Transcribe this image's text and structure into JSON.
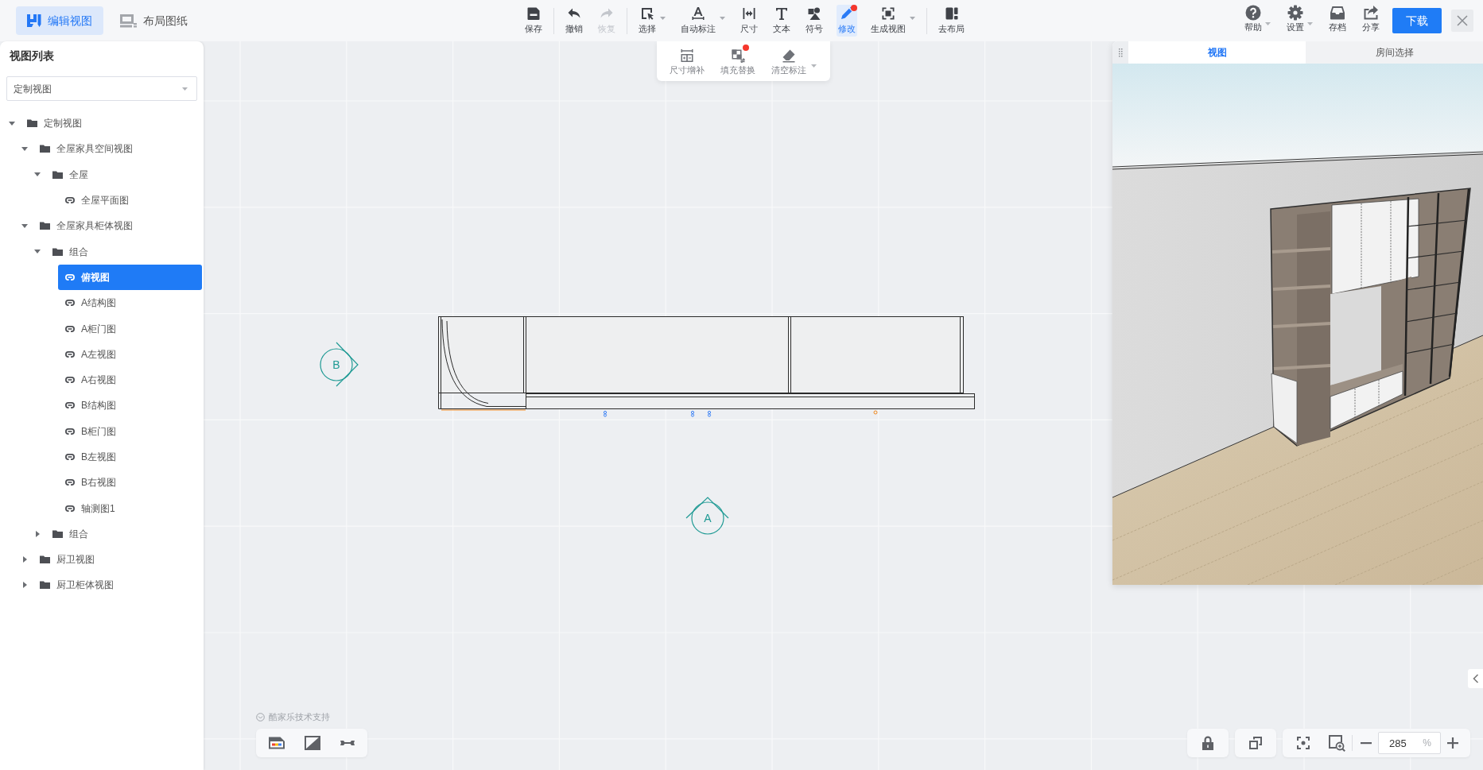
{
  "mode_tabs": [
    {
      "label": "编辑视图",
      "selected": true
    },
    {
      "label": "布局图纸",
      "selected": false
    }
  ],
  "toolbar_groups": [
    {
      "items": [
        {
          "label": "保存",
          "disabled": false,
          "selected": false,
          "has_menu": false,
          "badge": false
        }
      ]
    },
    {
      "items": [
        {
          "label": "撤销",
          "disabled": false,
          "selected": false,
          "has_menu": false,
          "badge": false
        },
        {
          "label": "恢复",
          "disabled": true,
          "selected": false,
          "has_menu": false,
          "badge": false
        }
      ]
    },
    {
      "items": [
        {
          "label": "选择",
          "disabled": false,
          "selected": false,
          "has_menu": true,
          "badge": false
        },
        {
          "label": "自动标注",
          "disabled": false,
          "selected": false,
          "has_menu": true,
          "badge": false
        },
        {
          "label": "尺寸",
          "disabled": false,
          "selected": false,
          "has_menu": false,
          "badge": false
        },
        {
          "label": "文本",
          "disabled": false,
          "selected": false,
          "has_menu": false,
          "badge": false
        },
        {
          "label": "符号",
          "disabled": false,
          "selected": false,
          "has_menu": false,
          "badge": false
        },
        {
          "label": "修改",
          "disabled": false,
          "selected": true,
          "has_menu": false,
          "badge": true
        },
        {
          "label": "生成视图",
          "disabled": false,
          "selected": false,
          "has_menu": true,
          "badge": false
        }
      ]
    },
    {
      "items": [
        {
          "label": "去布局",
          "disabled": false,
          "selected": false,
          "has_menu": false,
          "badge": false
        }
      ]
    }
  ],
  "edit_submenu": [
    {
      "label": "尺寸增补",
      "badge": false,
      "has_menu": false
    },
    {
      "label": "填充替换",
      "badge": true,
      "has_menu": false
    },
    {
      "label": "清空标注",
      "badge": false,
      "has_menu": true
    }
  ],
  "header_right": {
    "actions": [
      {
        "label": "帮助",
        "has_menu": true
      },
      {
        "label": "设置",
        "has_menu": true
      },
      {
        "label": "存档",
        "has_menu": false
      },
      {
        "label": "分享",
        "has_menu": false
      }
    ],
    "download_button": "下载"
  },
  "sidebar": {
    "title": "视图列表",
    "view_select": {
      "value": "定制视图"
    },
    "tree": [
      {
        "label": "定制视图",
        "kind": "folder",
        "expanded": true,
        "selected": false,
        "children": [
          {
            "label": "全屋家具空间视图",
            "kind": "folder",
            "expanded": true,
            "selected": false,
            "children": [
              {
                "label": "全屋",
                "kind": "folder",
                "expanded": true,
                "selected": false,
                "children": [
                  {
                    "label": "全屋平面图",
                    "kind": "view",
                    "selected": false
                  }
                ]
              }
            ]
          },
          {
            "label": "全屋家具柜体视图",
            "kind": "folder",
            "expanded": true,
            "selected": false,
            "children": [
              {
                "label": "组合",
                "kind": "folder",
                "expanded": true,
                "selected": false,
                "children": [
                  {
                    "label": "俯视图",
                    "kind": "view",
                    "selected": true
                  },
                  {
                    "label": "A结构图",
                    "kind": "view",
                    "selected": false
                  },
                  {
                    "label": "A柜门图",
                    "kind": "view",
                    "selected": false
                  },
                  {
                    "label": "A左视图",
                    "kind": "view",
                    "selected": false
                  },
                  {
                    "label": "A右视图",
                    "kind": "view",
                    "selected": false
                  },
                  {
                    "label": "B结构图",
                    "kind": "view",
                    "selected": false
                  },
                  {
                    "label": "B柜门图",
                    "kind": "view",
                    "selected": false
                  },
                  {
                    "label": "B左视图",
                    "kind": "view",
                    "selected": false
                  },
                  {
                    "label": "B右视图",
                    "kind": "view",
                    "selected": false
                  },
                  {
                    "label": "轴测图1",
                    "kind": "view",
                    "selected": false
                  }
                ]
              },
              {
                "label": "组合",
                "kind": "folder",
                "expanded": false,
                "selected": false
              }
            ]
          },
          {
            "label": "厨卫视图",
            "kind": "folder",
            "expanded": false,
            "selected": false
          },
          {
            "label": "厨卫柜体视图",
            "kind": "folder",
            "expanded": false,
            "selected": false
          }
        ]
      }
    ]
  },
  "canvas": {
    "markers": [
      {
        "label": "B",
        "kind": "right"
      },
      {
        "label": "A",
        "kind": "up"
      }
    ],
    "credit": "酷家乐技术支持",
    "zoom": {
      "value": "285",
      "unit": "%"
    }
  },
  "preview_panel": {
    "tabs": [
      {
        "label": "视图",
        "selected": true
      },
      {
        "label": "房间选择",
        "selected": false
      }
    ]
  }
}
